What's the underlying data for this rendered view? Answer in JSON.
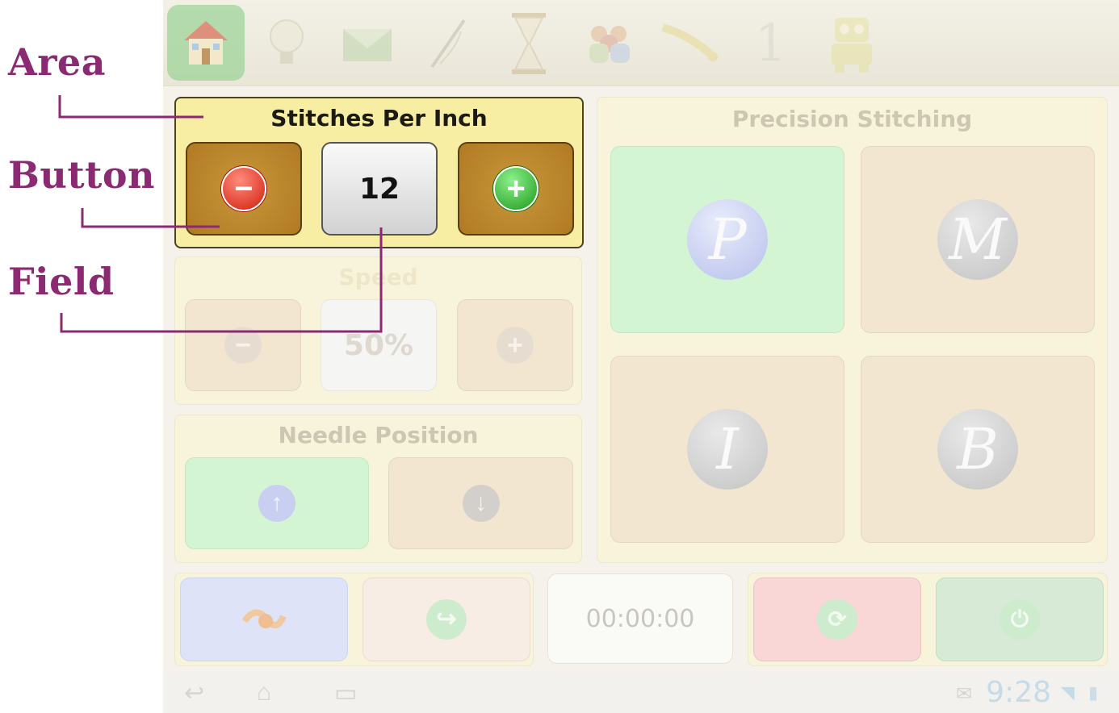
{
  "annotations": {
    "area": "Area",
    "button": "Button",
    "field": "Field"
  },
  "toolbar": {
    "items": [
      "home-icon",
      "lightbulb-icon",
      "envelope-icon",
      "needle-icon",
      "hourglass-icon",
      "people-icon",
      "tape-measure-icon",
      "1",
      "robot-icon"
    ]
  },
  "stitches": {
    "title": "Stitches Per Inch",
    "value": "12",
    "decrease": "−",
    "increase": "+"
  },
  "speed": {
    "title": "Speed",
    "value": "50%"
  },
  "needle": {
    "title": "Needle Position"
  },
  "precision": {
    "title": "Precision Stitching",
    "modes": [
      "P",
      "M",
      "I",
      "B"
    ]
  },
  "bottom": {
    "timer": "00:00:00"
  },
  "system": {
    "clock": "9:28"
  },
  "colors": {
    "annotation": "#8b2a72",
    "active_panel": "#f7eda3",
    "brown_button": "#b07a23",
    "green_tile": "#d4f5d4"
  }
}
